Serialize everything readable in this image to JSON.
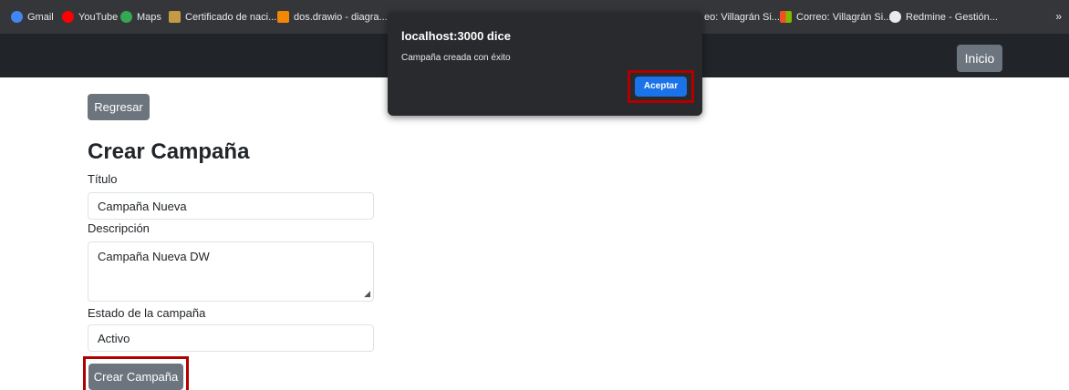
{
  "bookmarks": [
    {
      "label": "Gmail",
      "icon": "google-icon",
      "color": "#4285f4"
    },
    {
      "label": "YouTube",
      "icon": "youtube-icon",
      "color": "#ff0000"
    },
    {
      "label": "Maps",
      "icon": "maps-icon",
      "color": "#34a853"
    },
    {
      "label": "Certificado de naci...",
      "icon": "folder-icon",
      "color": "#c49a44"
    },
    {
      "label": "dos.drawio - diagra...",
      "icon": "drawio-icon",
      "color": "#f08705"
    },
    {
      "label": "eo: Villagrán Si...",
      "icon": "outlook-icon",
      "color": "#0078d4"
    },
    {
      "label": "Correo: Villagrán Si...",
      "icon": "microsoft-icon",
      "color": "#f25022"
    },
    {
      "label": "Redmine - Gestión...",
      "icon": "globe-icon",
      "color": "#e8eaed"
    }
  ],
  "bookmarks_overflow": "»",
  "navbar": {
    "home_button": "Inicio"
  },
  "form": {
    "back_button": "Regresar",
    "title": "Crear Campaña",
    "title_label": "Título",
    "title_value": "Campaña Nueva",
    "description_label": "Descripción",
    "description_value": "Campaña Nueva DW",
    "status_label": "Estado de la campaña",
    "status_value": "Activo",
    "submit_button": "Crear Campaña"
  },
  "dialog": {
    "title": "localhost:3000 dice",
    "message": "Campaña creada con éxito",
    "ok_button": "Aceptar"
  },
  "colors": {
    "highlight": "#b00000",
    "accept_blue": "#1a73e8",
    "secondary": "#6c757d"
  }
}
